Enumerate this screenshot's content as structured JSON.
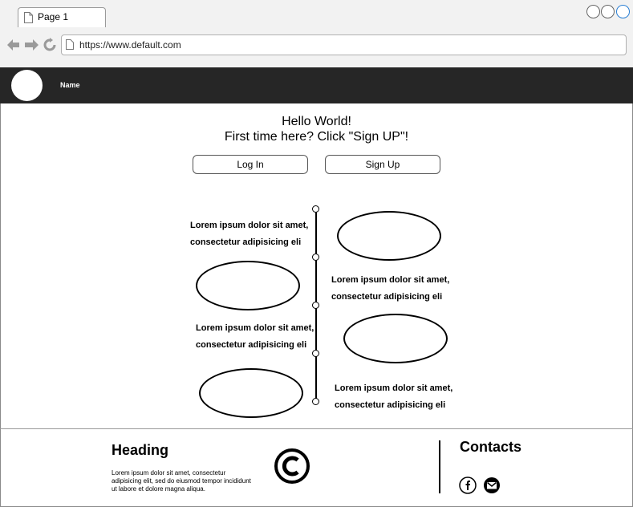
{
  "browser": {
    "tab_title": "Page 1",
    "url": "https://www.default.com"
  },
  "navbar": {
    "name": "Name"
  },
  "hero": {
    "line1": "Hello World!",
    "line2": "First time here? Click \"Sign UP\"!"
  },
  "buttons": {
    "login": "Log In",
    "signup": "Sign Up"
  },
  "timeline": {
    "items": [
      {
        "line1": "Lorem ipsum dolor sit amet,",
        "line2": "consectetur adipisicing eli"
      },
      {
        "line1": "Lorem ipsum dolor sit amet,",
        "line2": "consectetur adipisicing eli"
      },
      {
        "line1": "Lorem ipsum dolor sit amet,",
        "line2": "consectetur adipisicing eli"
      },
      {
        "line1": "Lorem ipsum dolor sit amet,",
        "line2": "consectetur adipisicing eli"
      }
    ]
  },
  "footer": {
    "heading": "Heading",
    "text": "Lorem ipsum dolor sit amet, consectetur adipisicing elit, sed do eiusmod tempor incididunt ut labore et dolore magna aliqua.",
    "contacts": "Contacts",
    "icons": [
      "copyright-icon",
      "facebook-icon",
      "mail-icon"
    ]
  }
}
